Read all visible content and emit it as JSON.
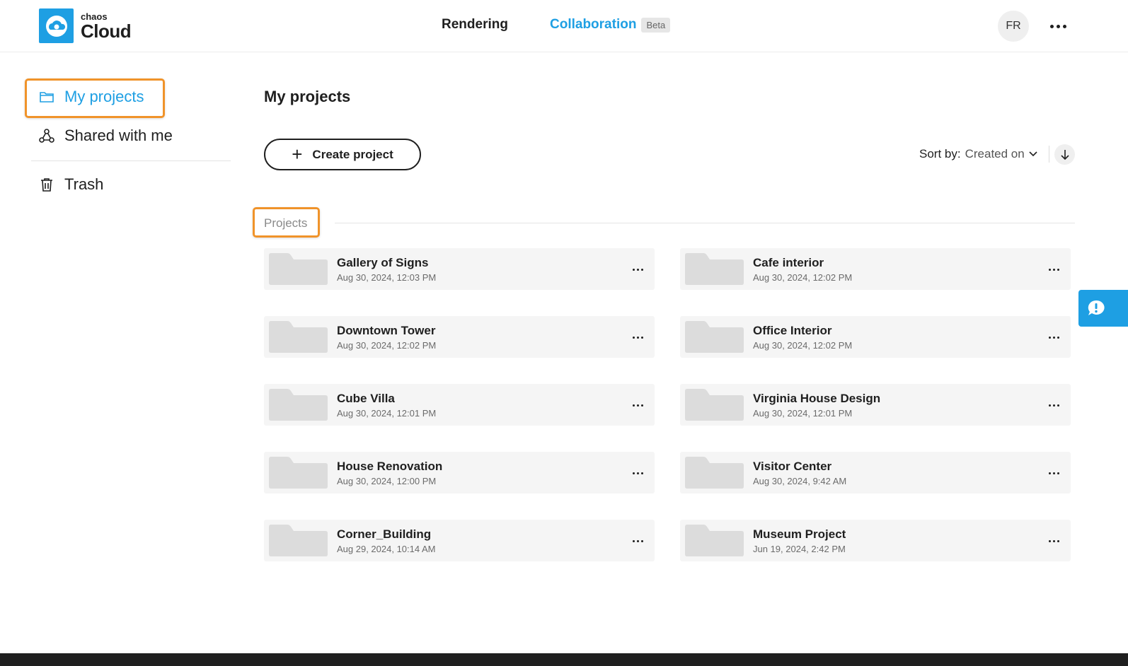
{
  "brand": {
    "small": "chaos",
    "big": "Cloud",
    "color": "#1e9fe3"
  },
  "nav": {
    "rendering": "Rendering",
    "collaboration": "Collaboration",
    "beta": "Beta"
  },
  "user": {
    "initials": "FR"
  },
  "sidebar": {
    "items": [
      {
        "label": "My projects",
        "icon": "folder-icon",
        "active": true
      },
      {
        "label": "Shared with me",
        "icon": "share-icon",
        "active": false
      },
      {
        "label": "Trash",
        "icon": "trash-icon",
        "active": false
      }
    ]
  },
  "main": {
    "title": "My projects",
    "create_label": "Create project",
    "sort_label": "Sort by:",
    "sort_value": "Created on",
    "section_label": "Projects"
  },
  "projects": [
    {
      "name": "Gallery of Signs",
      "date": "Aug 30, 2024, 12:03 PM"
    },
    {
      "name": "Cafe interior",
      "date": "Aug 30, 2024, 12:02 PM"
    },
    {
      "name": "Downtown Tower",
      "date": "Aug 30, 2024, 12:02 PM"
    },
    {
      "name": "Office Interior",
      "date": "Aug 30, 2024, 12:02 PM"
    },
    {
      "name": "Cube Villa",
      "date": "Aug 30, 2024, 12:01 PM"
    },
    {
      "name": "Virginia House Design",
      "date": "Aug 30, 2024, 12:01 PM"
    },
    {
      "name": "House Renovation",
      "date": "Aug 30, 2024, 12:00 PM"
    },
    {
      "name": "Visitor Center",
      "date": "Aug 30, 2024, 9:42 AM"
    },
    {
      "name": "Corner_Building",
      "date": "Aug 29, 2024, 10:14 AM"
    },
    {
      "name": "Museum Project",
      "date": "Jun 19, 2024, 2:42 PM"
    }
  ],
  "colors": {
    "accent": "#1e9fe3",
    "highlight": "#f0932a",
    "card_bg": "#f5f5f5"
  }
}
